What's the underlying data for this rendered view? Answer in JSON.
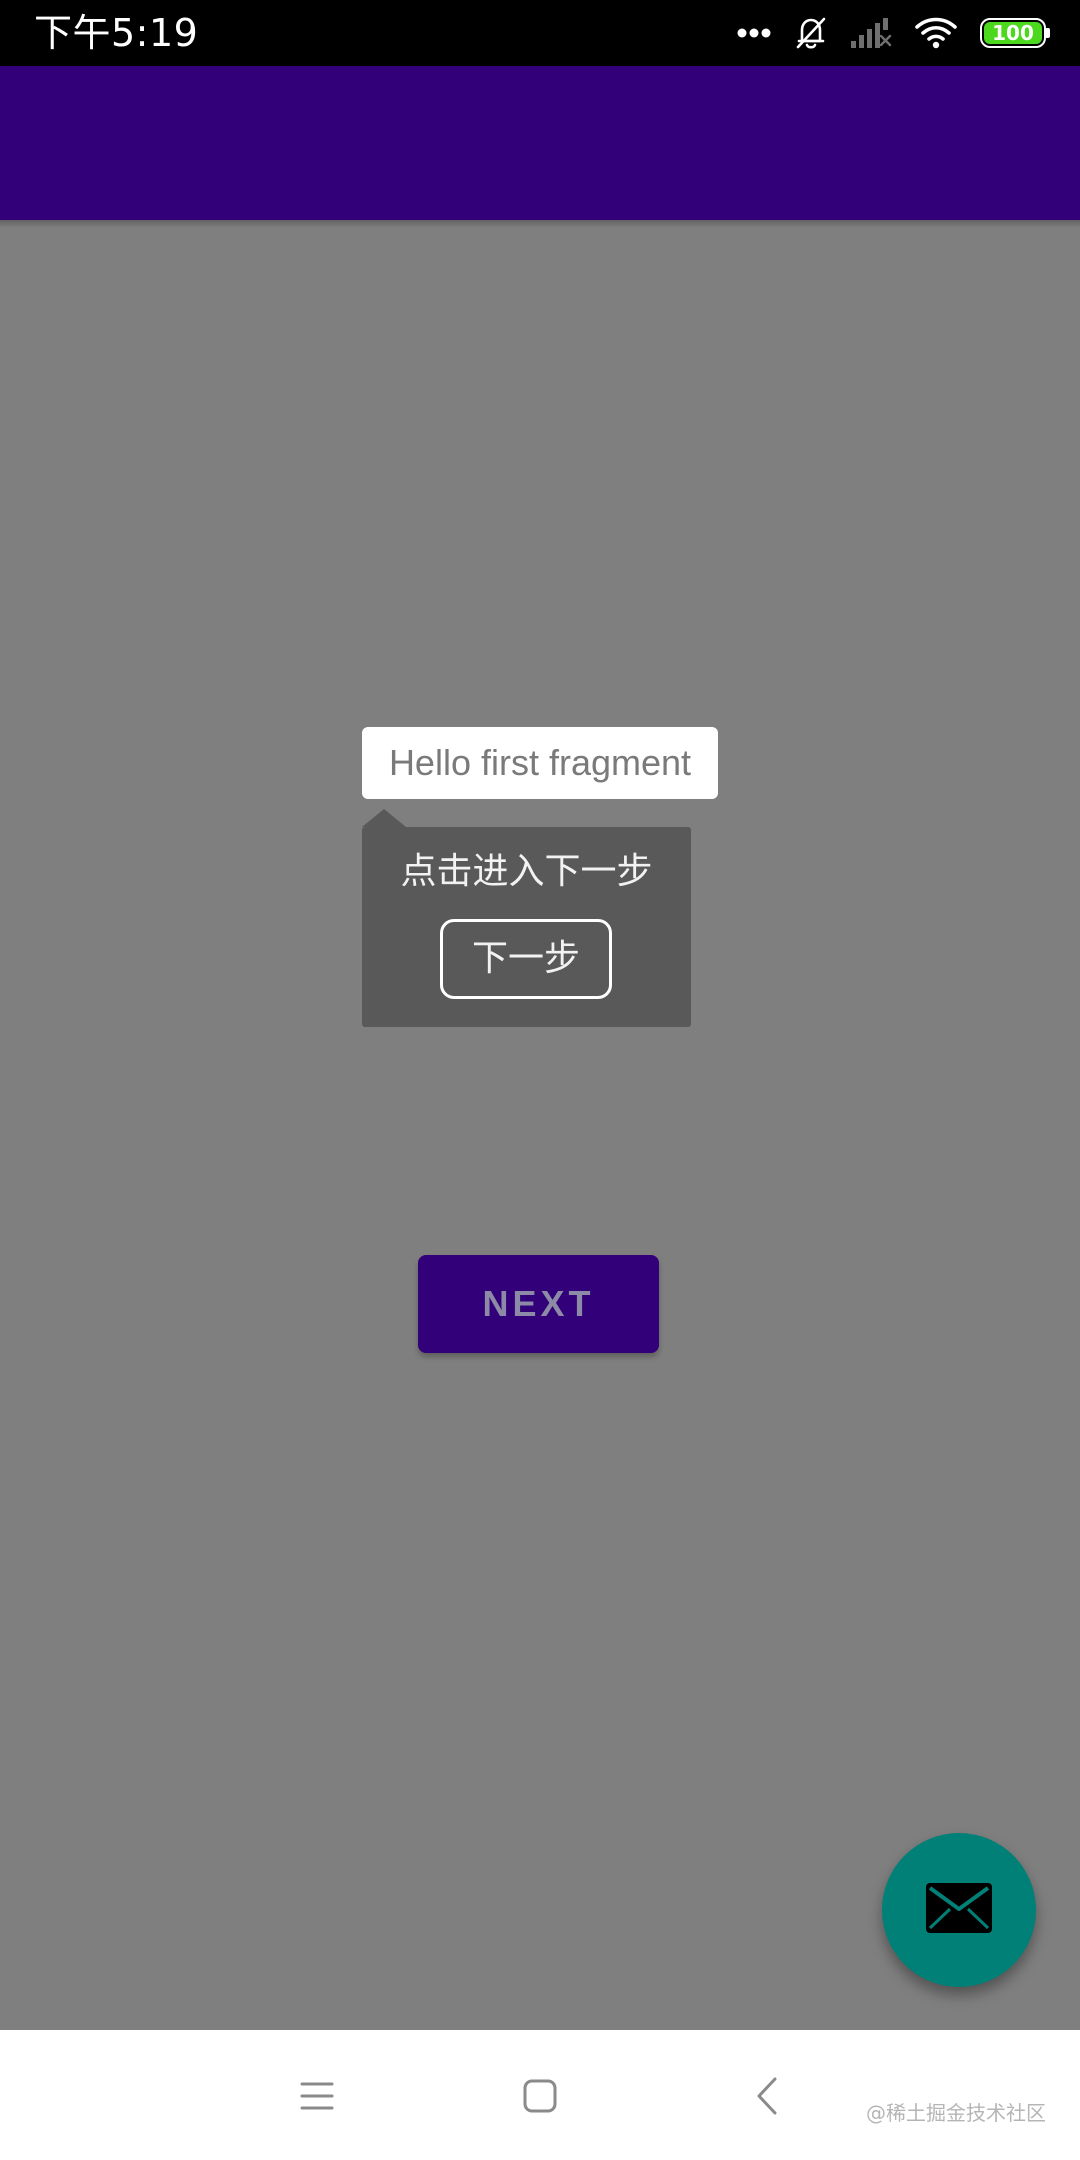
{
  "status_bar": {
    "time": "下午5:19",
    "battery_level": "100",
    "battery_color": "#4cd81c",
    "icons": [
      "more-dots-icon",
      "bell-off-icon",
      "cellular-signal-no-service-icon",
      "wifi-icon",
      "battery-icon"
    ]
  },
  "app_bar": {
    "color": "#320079"
  },
  "content": {
    "background": "#7f7f7f",
    "hello_text": "Hello first fragment",
    "next_button_label": "NEXT"
  },
  "guide_tooltip": {
    "message": "点击进入下一步",
    "button_label": "下一步"
  },
  "fab": {
    "icon": "email-icon",
    "color": "#008077"
  },
  "nav_bar": {
    "buttons": [
      "menu-icon",
      "home-icon",
      "back-icon"
    ]
  },
  "watermark": "@稀土掘金技术社区"
}
